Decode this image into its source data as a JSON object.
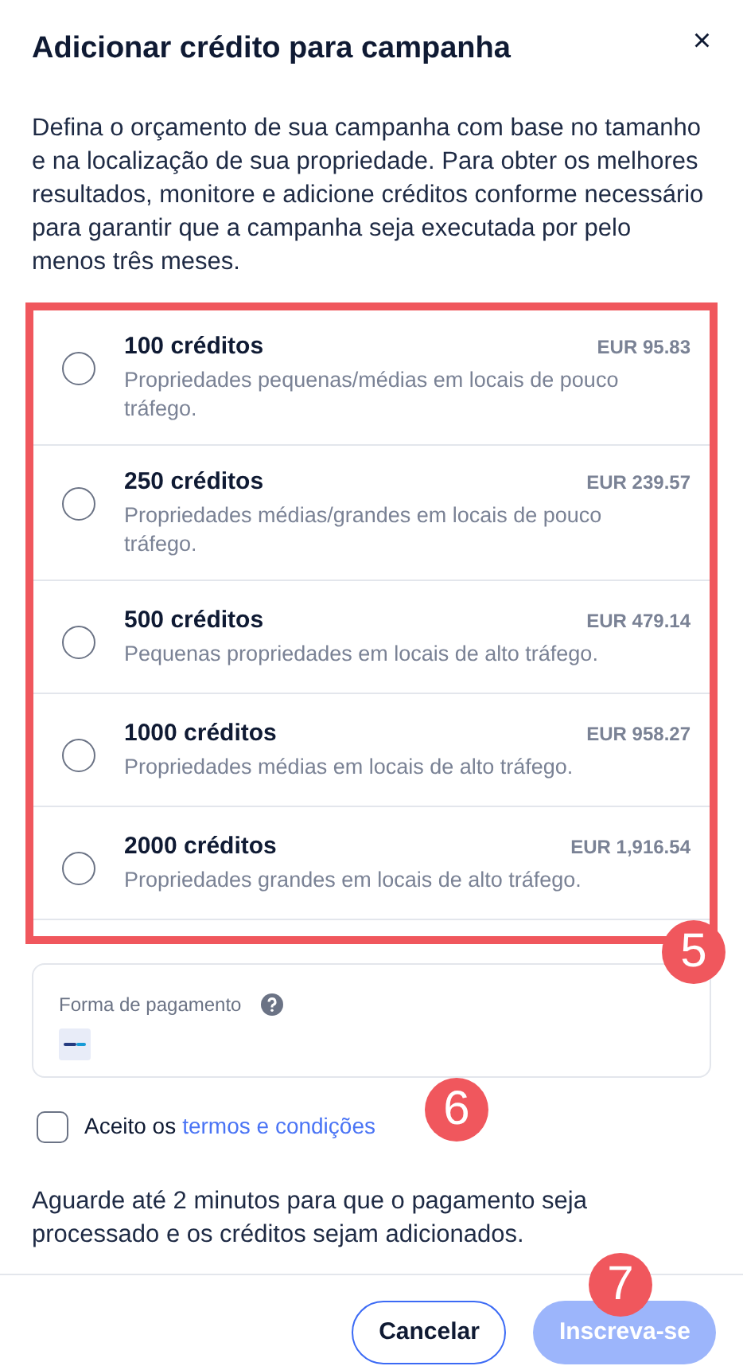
{
  "dialog": {
    "title": "Adicionar crédito para campanha",
    "close": "×",
    "description": "Defina o orçamento de sua campanha com base no tamanho e na localização de sua propriedade. Para obter os melhores resultados, monitore e adicione créditos conforme necessário para garantir que a campanha seja executada por pelo menos três meses."
  },
  "options": [
    {
      "title": "100 créditos",
      "price": "EUR 95.83",
      "description": "Propriedades pequenas/médias em locais de pouco tráfego.",
      "selected": false
    },
    {
      "title": "250 créditos",
      "price": "EUR 239.57",
      "description": "Propriedades médias/grandes em locais de pouco tráfego.",
      "selected": false
    },
    {
      "title": "500 créditos",
      "price": "EUR 479.14",
      "description": "Pequenas propriedades em locais de alto tráfego.",
      "selected": false
    },
    {
      "title": "1000 créditos",
      "price": "EUR 958.27",
      "description": "Propriedades médias em locais de alto tráfego.",
      "selected": false
    },
    {
      "title": "2000 créditos",
      "price": "EUR 1,916.54",
      "description": "Propriedades grandes em locais de alto tráfego.",
      "selected": false
    }
  ],
  "payment": {
    "label": "Forma de pagamento"
  },
  "terms": {
    "checked": false,
    "prefix": "Aceito os",
    "link": "termos e condições"
  },
  "note": "Aguarde até 2 minutos para que o pagamento seja processado e os créditos sejam adicionados.",
  "buttons": [
    {
      "kind": "secondary",
      "label": "Cancelar",
      "disabled": false
    },
    {
      "kind": "primary",
      "label": "Inscreva-se",
      "disabled": true
    }
  ],
  "callouts": [
    "5",
    "6",
    "7"
  ]
}
